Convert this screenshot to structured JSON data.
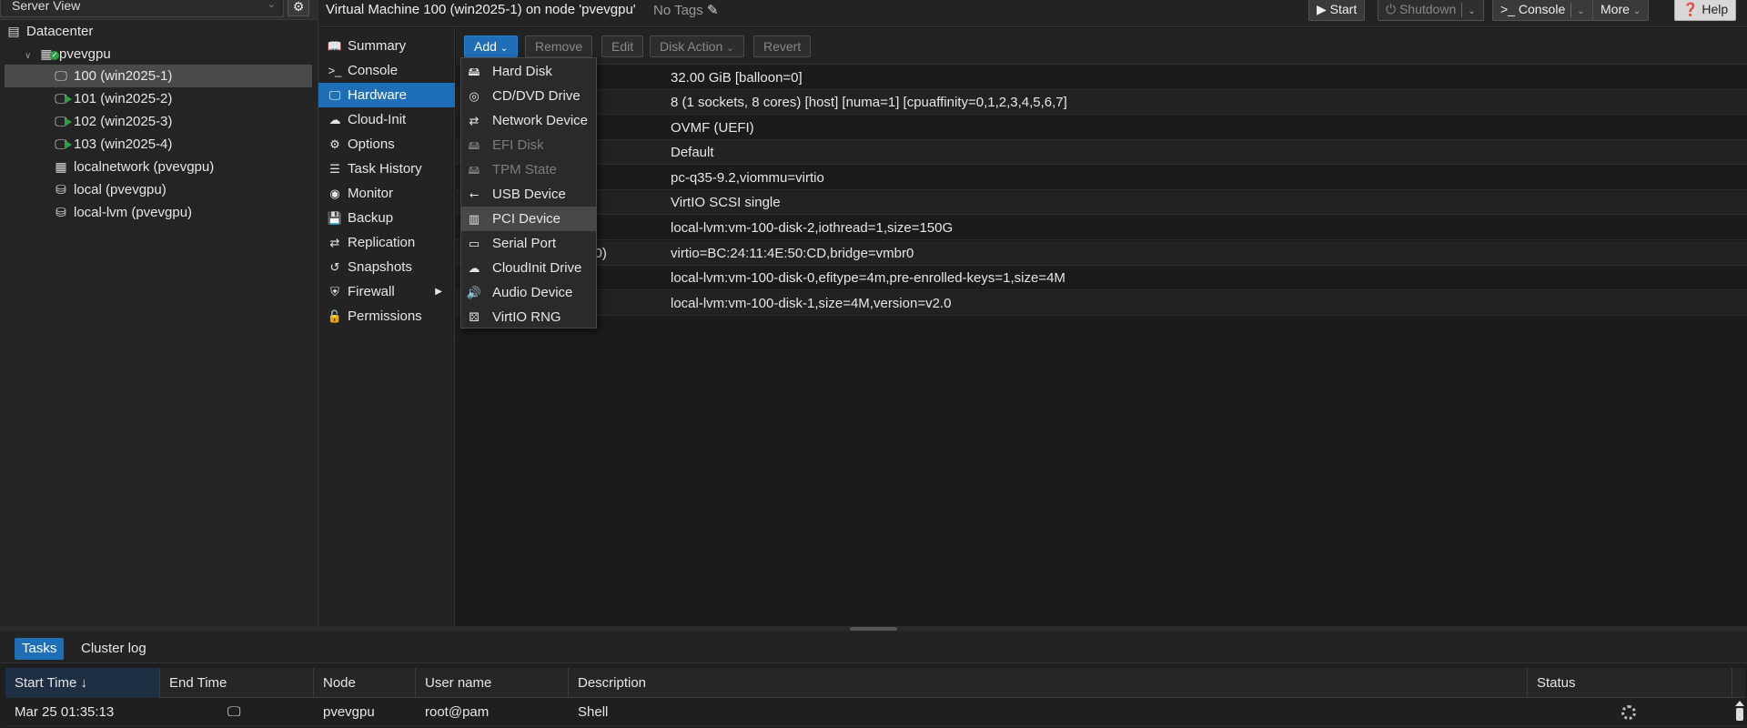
{
  "tree": {
    "view_label": "Server View",
    "items": [
      {
        "label": "Datacenter",
        "icon": "datacenter-icon"
      },
      {
        "label": "pvevgpu",
        "icon": "node-online-icon"
      },
      {
        "label": "100 (win2025-1)",
        "icon": "vm-stopped-icon"
      },
      {
        "label": "101 (win2025-2)",
        "icon": "vm-running-icon"
      },
      {
        "label": "102 (win2025-3)",
        "icon": "vm-running-icon"
      },
      {
        "label": "103 (win2025-4)",
        "icon": "vm-running-icon"
      },
      {
        "label": "localnetwork (pvevgpu)",
        "icon": "sdn-icon"
      },
      {
        "label": "local (pvevgpu)",
        "icon": "storage-icon"
      },
      {
        "label": "local-lvm (pvevgpu)",
        "icon": "storage-icon"
      }
    ]
  },
  "header": {
    "title": "Virtual Machine 100 (win2025-1) on node 'pvevgpu'",
    "tags": "No Tags",
    "start": "Start",
    "shutdown": "Shutdown",
    "console": "Console",
    "more": "More",
    "help": "Help"
  },
  "nav": {
    "items": [
      {
        "label": "Summary",
        "icon": "book-icon"
      },
      {
        "label": "Console",
        "icon": "terminal-icon"
      },
      {
        "label": "Hardware",
        "icon": "monitor-icon"
      },
      {
        "label": "Cloud-Init",
        "icon": "cloud-icon"
      },
      {
        "label": "Options",
        "icon": "gear-icon"
      },
      {
        "label": "Task History",
        "icon": "list-icon"
      },
      {
        "label": "Monitor",
        "icon": "eye-icon"
      },
      {
        "label": "Backup",
        "icon": "floppy-icon"
      },
      {
        "label": "Replication",
        "icon": "retweet-icon"
      },
      {
        "label": "Snapshots",
        "icon": "history-icon"
      },
      {
        "label": "Firewall",
        "icon": "shield-icon"
      },
      {
        "label": "Permissions",
        "icon": "unlock-icon"
      }
    ]
  },
  "toolbar": {
    "add": "Add",
    "remove": "Remove",
    "edit": "Edit",
    "disk_action": "Disk Action",
    "revert": "Revert"
  },
  "hardware": {
    "rows": [
      {
        "key": "",
        "value": "32.00 GiB [balloon=0]"
      },
      {
        "key": "",
        "value": "8 (1 sockets, 8 cores) [host] [numa=1] [cpuaffinity=0,1,2,3,4,5,6,7]"
      },
      {
        "key": "",
        "value": "OVMF (UEFI)"
      },
      {
        "key": "",
        "value": "Default"
      },
      {
        "key": "",
        "value": "pc-q35-9.2,viommu=virtio"
      },
      {
        "key": "",
        "value": "VirtIO SCSI single"
      },
      {
        "key": "",
        "value": "local-lvm:vm-100-disk-2,iothread=1,size=150G"
      },
      {
        "key": "et0)",
        "value": "virtio=BC:24:11:4E:50:CD,bridge=vmbr0"
      },
      {
        "key": "",
        "value": "local-lvm:vm-100-disk-0,efitype=4m,pre-enrolled-keys=1,size=4M"
      },
      {
        "key": "",
        "value": "local-lvm:vm-100-disk-1,size=4M,version=v2.0"
      }
    ]
  },
  "add_menu": {
    "items": [
      {
        "label": "Hard Disk",
        "icon": "hdd-icon",
        "enabled": true
      },
      {
        "label": "CD/DVD Drive",
        "icon": "cdrom-icon",
        "enabled": true
      },
      {
        "label": "Network Device",
        "icon": "exchange-icon",
        "enabled": true
      },
      {
        "label": "EFI Disk",
        "icon": "hdd-icon",
        "enabled": false
      },
      {
        "label": "TPM State",
        "icon": "hdd-icon",
        "enabled": false
      },
      {
        "label": "USB Device",
        "icon": "usb-icon",
        "enabled": true
      },
      {
        "label": "PCI Device",
        "icon": "pci-icon",
        "enabled": true
      },
      {
        "label": "Serial Port",
        "icon": "serial-icon",
        "enabled": true
      },
      {
        "label": "CloudInit Drive",
        "icon": "cloud-icon",
        "enabled": true
      },
      {
        "label": "Audio Device",
        "icon": "volume-icon",
        "enabled": true
      },
      {
        "label": "VirtIO RNG",
        "icon": "dice-icon",
        "enabled": true
      }
    ]
  },
  "bottom": {
    "tabs": [
      "Tasks",
      "Cluster log"
    ],
    "columns": [
      "Start Time ↓",
      "End Time",
      "Node",
      "User name",
      "Description",
      "Status"
    ],
    "row": {
      "start": "Mar 25 01:35:13",
      "end_icon": "monitor-icon",
      "node": "pvevgpu",
      "user": "root@pam",
      "description": "Shell",
      "status_icon": "spinner-icon"
    }
  }
}
